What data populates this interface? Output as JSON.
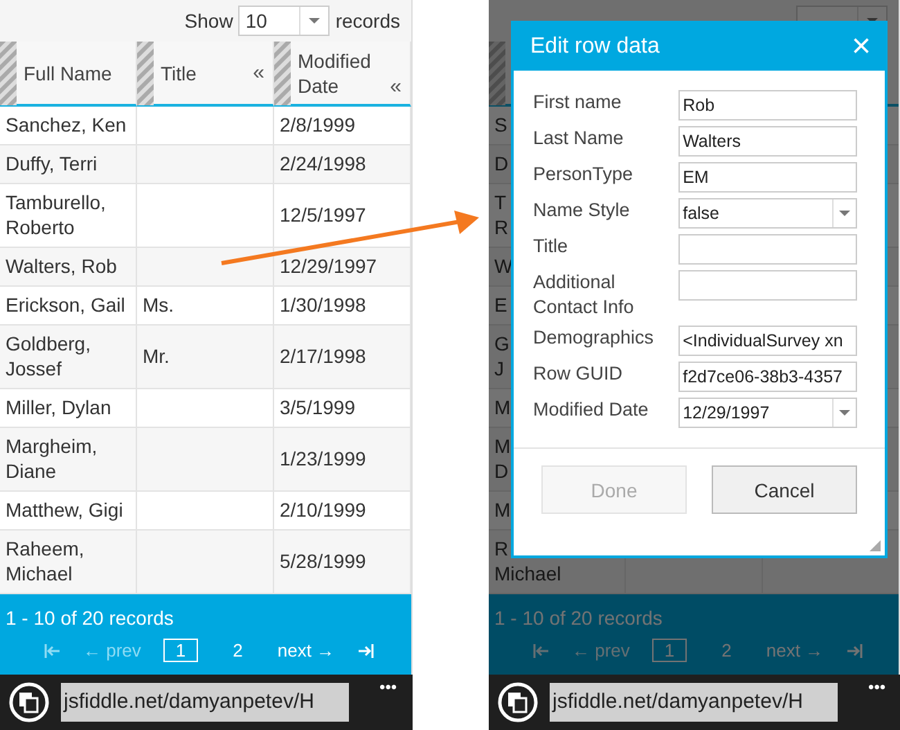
{
  "left_phone": {
    "page_size": {
      "label": "Show",
      "value": "10",
      "suffix": "records"
    },
    "columns": [
      {
        "label": "Full Name"
      },
      {
        "label": "Title",
        "toggle": "«"
      },
      {
        "label": "Modified Date",
        "toggle": "«"
      }
    ],
    "rows": [
      {
        "full_name": "Sanchez, Ken",
        "modified_date": "2/8/1999"
      },
      {
        "full_name": "Duffy, Terri",
        "modified_date": "2/24/1998"
      },
      {
        "full_name": "Tamburello, Roberto",
        "modified_date": "12/5/1997"
      },
      {
        "full_name": "Walters, Rob",
        "modified_date": "12/29/1997"
      },
      {
        "full_name": "Erickson, Gail",
        "title": "Ms.",
        "modified_date": "1/30/1998"
      },
      {
        "full_name": "Goldberg, Jossef",
        "title": "Mr.",
        "modified_date": "2/17/1998"
      },
      {
        "full_name": "Miller, Dylan",
        "modified_date": "3/5/1999"
      },
      {
        "full_name": "Margheim, Diane",
        "modified_date": "1/23/1999"
      },
      {
        "full_name": "Matthew, Gigi",
        "modified_date": "2/10/1999"
      },
      {
        "full_name": "Raheem, Michael",
        "modified_date": "5/28/1999"
      }
    ],
    "footer": {
      "summary": "1 - 10 of 20 records",
      "pager": [
        {
          "kind": "first",
          "disabled": true
        },
        {
          "kind": "prev",
          "label": "← prev",
          "disabled": true
        },
        {
          "kind": "page",
          "label": "1",
          "selected": true
        },
        {
          "kind": "page",
          "label": "2",
          "selected": false
        },
        {
          "kind": "next",
          "label": "next →",
          "disabled": false
        },
        {
          "kind": "last",
          "disabled": false
        }
      ]
    },
    "browser": {
      "address": "jsfiddle.net/damyanpetev/H",
      "more": "•••"
    }
  },
  "right_phone": {
    "rows": [
      {
        "full_name": "S"
      },
      {
        "full_name": "D"
      },
      {
        "full_name": "T\nR"
      },
      {
        "full_name": "W"
      },
      {
        "full_name": "E"
      },
      {
        "full_name": "G\nJ"
      },
      {
        "full_name": "M"
      },
      {
        "full_name": "M\nD"
      },
      {
        "full_name": "M"
      },
      {
        "full_name": "R\nMichael"
      }
    ],
    "footer": {
      "summary": "1 - 10 of 20 records",
      "pager": [
        {
          "kind": "first",
          "disabled": true
        },
        {
          "kind": "prev",
          "label": "← prev",
          "disabled": true
        },
        {
          "kind": "page",
          "label": "1",
          "selected": true
        },
        {
          "kind": "page",
          "label": "2",
          "selected": false
        },
        {
          "kind": "next",
          "label": "next →",
          "disabled": false
        },
        {
          "kind": "last",
          "disabled": false
        }
      ]
    },
    "browser": {
      "address": "jsfiddle.net/damyanpetev/H",
      "more": "•••"
    },
    "dialog": {
      "title": "Edit row data",
      "close": "×",
      "fields": [
        {
          "label": "First name",
          "kind": "text",
          "value": "Rob"
        },
        {
          "label": "Last Name",
          "kind": "text",
          "value": "Walters"
        },
        {
          "label": "PersonType",
          "kind": "text",
          "value": "EM"
        },
        {
          "label": "Name Style",
          "kind": "select",
          "value": "false"
        },
        {
          "label": "Title",
          "kind": "text"
        },
        {
          "label": "Additional Contact Info",
          "kind": "text"
        },
        {
          "label": "Demographics",
          "kind": "text",
          "value": "<IndividualSurvey xn"
        },
        {
          "label": "Row GUID",
          "kind": "text",
          "value": "f2d7ce06-38b3-4357"
        },
        {
          "label": "Modified Date",
          "kind": "select",
          "value": "12/29/1997"
        }
      ],
      "buttons": [
        {
          "label": "Done",
          "disabled": true
        },
        {
          "label": "Cancel",
          "disabled": false
        }
      ]
    }
  }
}
